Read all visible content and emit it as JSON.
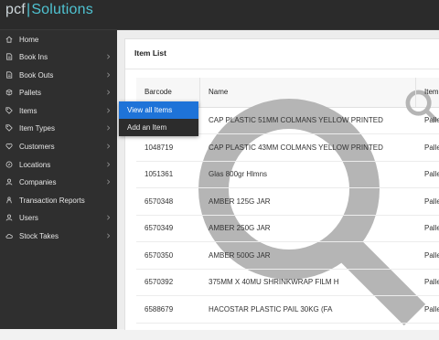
{
  "app": {
    "logo_left": "pcf",
    "logo_sep": "|",
    "logo_right": "Solutions"
  },
  "colors": {
    "sidebar_bg": "#2f2f2f",
    "accent": "#1e73d8",
    "logo_accent": "#4fc3d2"
  },
  "sidebar": {
    "items": [
      {
        "label": "Home",
        "icon": "home-icon",
        "has_submenu": false
      },
      {
        "label": "Book Ins",
        "icon": "document-icon",
        "has_submenu": true
      },
      {
        "label": "Book Outs",
        "icon": "document-icon",
        "has_submenu": true
      },
      {
        "label": "Pallets",
        "icon": "box-icon",
        "has_submenu": true
      },
      {
        "label": "Items",
        "icon": "tag-icon",
        "has_submenu": true
      },
      {
        "label": "Item Types",
        "icon": "tag-icon",
        "has_submenu": true
      },
      {
        "label": "Customers",
        "icon": "heart-icon",
        "has_submenu": true
      },
      {
        "label": "Locations",
        "icon": "compass-icon",
        "has_submenu": true
      },
      {
        "label": "Companies",
        "icon": "user-icon",
        "has_submenu": true
      },
      {
        "label": "Transaction Reports",
        "icon": "person-icon",
        "has_submenu": false
      },
      {
        "label": "Users",
        "icon": "user-icon",
        "has_submenu": true
      },
      {
        "label": "Stock Takes",
        "icon": "cloud-icon",
        "has_submenu": true
      }
    ]
  },
  "items_flyout": {
    "items": [
      {
        "label": "View all Items",
        "active": true
      },
      {
        "label": "Add an Item",
        "active": false
      }
    ]
  },
  "main": {
    "title": "Item List",
    "columns": [
      "Barcode",
      "Name",
      "Item"
    ],
    "rows": [
      {
        "barcode": "",
        "name": "CAP PLASTIC 51MM COLMANS YELLOW PRINTED",
        "type": "Pallet"
      },
      {
        "barcode": "1048719",
        "name": "CAP PLASTIC 43MM COLMANS YELLOW PRINTED",
        "type": "Pallet"
      },
      {
        "barcode": "1051361",
        "name": "Glas 800gr Hlmns",
        "type": "Pallet"
      },
      {
        "barcode": "6570348",
        "name": "AMBER 125G JAR",
        "type": "Pallet"
      },
      {
        "barcode": "6570349",
        "name": "AMBER 250G JAR",
        "type": "Pallet"
      },
      {
        "barcode": "6570350",
        "name": "AMBER 500G JAR",
        "type": "Pallet"
      },
      {
        "barcode": "6570392",
        "name": "375MM X 40MU SHRINKWRAP FILM H",
        "type": "Pallet"
      },
      {
        "barcode": "6588679",
        "name": "HACOSTAR PLASTIC PAIL 30KG (FA",
        "type": "Pallet"
      }
    ]
  }
}
